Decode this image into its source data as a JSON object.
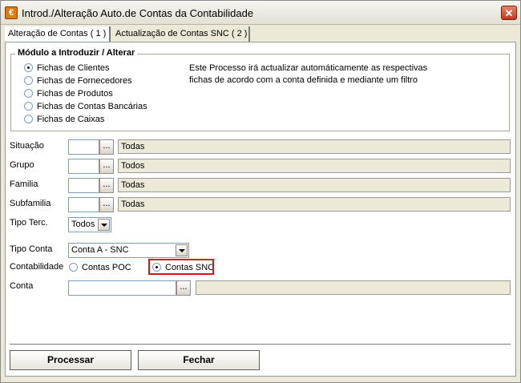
{
  "window": {
    "title": "Introd./Alteração Auto.de Contas da Contabilidade",
    "app_icon": "€",
    "close_glyph": "✕"
  },
  "tabs": [
    {
      "label": "Alteração de Contas ( 1 )",
      "active": true
    },
    {
      "label": "Actualização de Contas SNC ( 2 )",
      "active": false
    }
  ],
  "module_group": {
    "title": "Módulo a Introduzir / Alterar",
    "options": [
      {
        "label": "Fichas de Clientes",
        "selected": true
      },
      {
        "label": "Fichas de Fornecedores",
        "selected": false
      },
      {
        "label": "Fichas de Produtos",
        "selected": false
      },
      {
        "label": "Fichas de Contas Bancárias",
        "selected": false
      },
      {
        "label": "Fichas de Caixas",
        "selected": false
      }
    ],
    "note_line1": "Este Processo irá actualizar automáticamente as respectivas",
    "note_line2": "fichas de acordo com a conta definida e mediante um filtro"
  },
  "filters": [
    {
      "label": "Situação",
      "code": "",
      "button": "...",
      "description": "Todas"
    },
    {
      "label": "Grupo",
      "code": "",
      "button": "...",
      "description": "Todos"
    },
    {
      "label": "Familia",
      "code": "",
      "button": "...",
      "description": "Todas"
    },
    {
      "label": "Subfamilia",
      "code": "",
      "button": "...",
      "description": "Todas"
    }
  ],
  "tipo_terc": {
    "label": "Tipo Terc.",
    "value": "Todos"
  },
  "tipo_conta": {
    "label": "Tipo Conta",
    "value": "Conta A - SNC"
  },
  "contabilidade": {
    "label": "Contabilidade",
    "options": [
      {
        "label": "Contas POC",
        "selected": false
      },
      {
        "label": "Contas SNC",
        "selected": true
      }
    ],
    "highlight_color": "#e01010"
  },
  "conta": {
    "label": "Conta",
    "value": "",
    "button": "...",
    "description": ""
  },
  "buttons": {
    "process": "Processar",
    "close": "Fechar"
  },
  "colors": {
    "face": "#ece9d8",
    "accent_border": "#7f9db9"
  }
}
